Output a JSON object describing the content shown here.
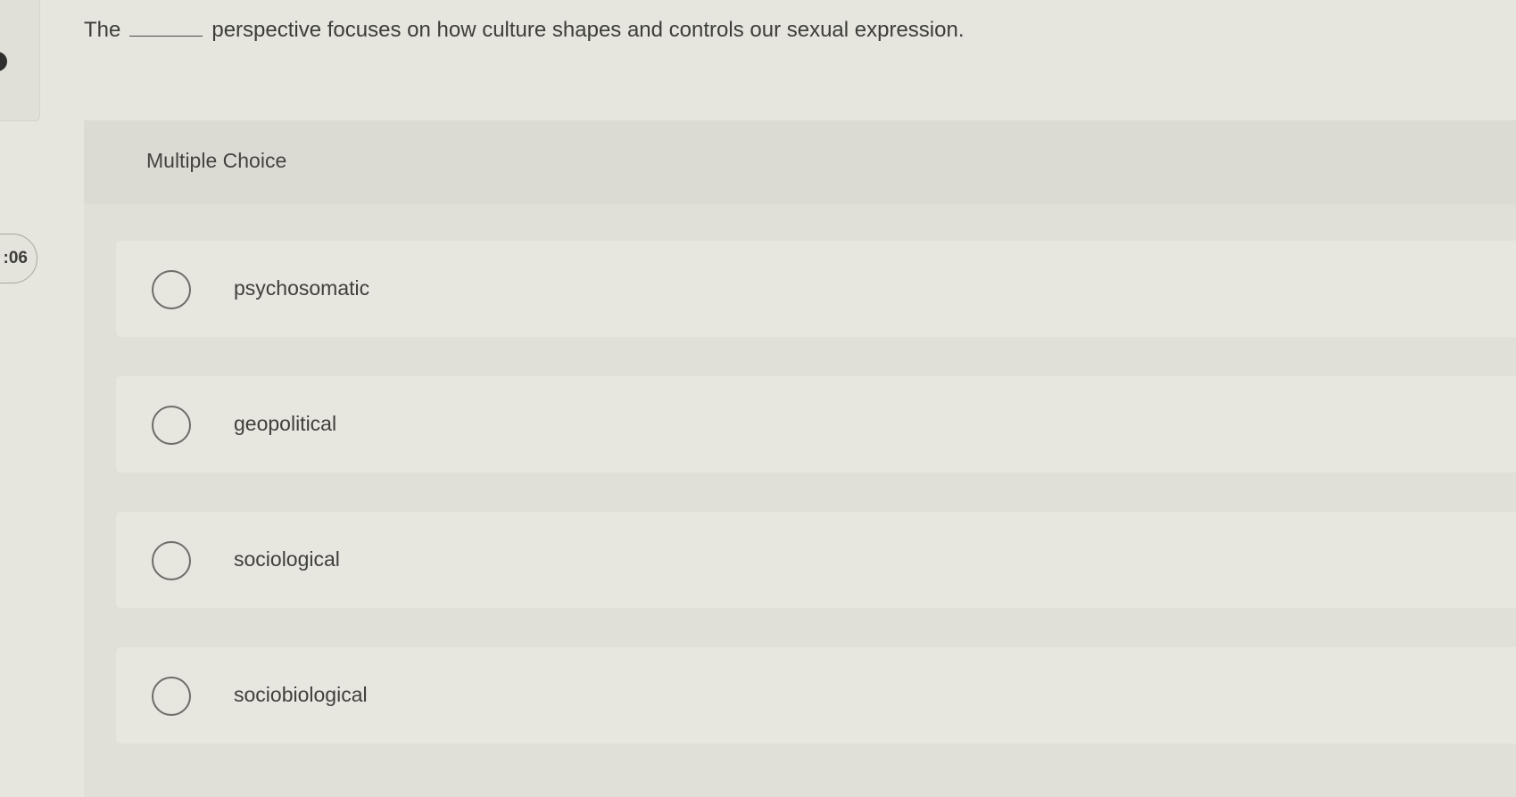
{
  "question": {
    "prefix": "The",
    "suffix": "perspective focuses on how culture shapes and controls our sexual expression."
  },
  "timer": {
    "text": ":06"
  },
  "panel": {
    "type_label": "Multiple Choice"
  },
  "options": [
    {
      "label": "psychosomatic",
      "selected": false
    },
    {
      "label": "geopolitical",
      "selected": false
    },
    {
      "label": "sociological",
      "selected": false
    },
    {
      "label": "sociobiological",
      "selected": false
    }
  ]
}
